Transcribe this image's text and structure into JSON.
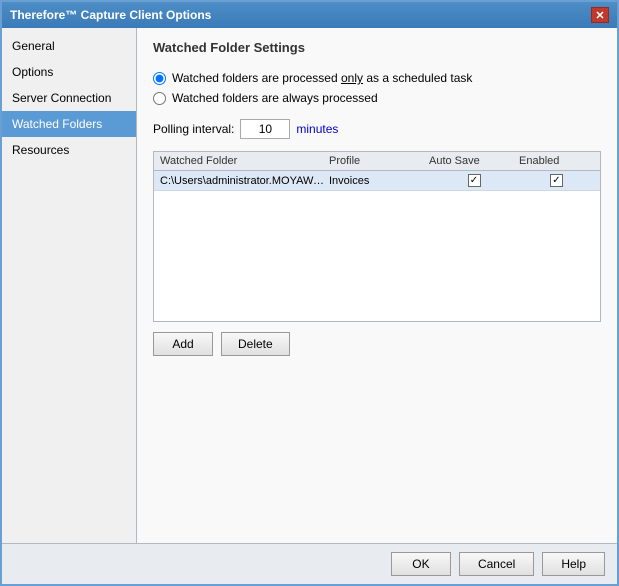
{
  "window": {
    "title": "Therefore™ Capture Client Options",
    "close_btn": "✕"
  },
  "sidebar": {
    "items": [
      {
        "id": "general",
        "label": "General",
        "active": false
      },
      {
        "id": "options",
        "label": "Options",
        "active": false
      },
      {
        "id": "server-connection",
        "label": "Server Connection",
        "active": false
      },
      {
        "id": "watched-folders",
        "label": "Watched Folders",
        "active": true
      },
      {
        "id": "resources",
        "label": "Resources",
        "active": false
      }
    ]
  },
  "content": {
    "section_title": "Watched Folder Settings",
    "radio_scheduled": "Watched folders are processed",
    "radio_scheduled_emphasis": "only",
    "radio_scheduled_suffix": "as a scheduled task",
    "radio_always": "Watched folders are always processed",
    "polling_label": "Polling interval:",
    "polling_value": "10",
    "polling_unit": "minutes",
    "table": {
      "headers": [
        "Watched Folder",
        "Profile",
        "Auto Save",
        "Enabled"
      ],
      "rows": [
        {
          "folder": "C:\\Users\\administrator.MOYAWARE\\Desk...",
          "profile": "Invoices",
          "auto_save": true,
          "enabled": true
        }
      ]
    },
    "add_button": "Add",
    "delete_button": "Delete"
  },
  "footer": {
    "ok": "OK",
    "cancel": "Cancel",
    "help": "Help"
  }
}
